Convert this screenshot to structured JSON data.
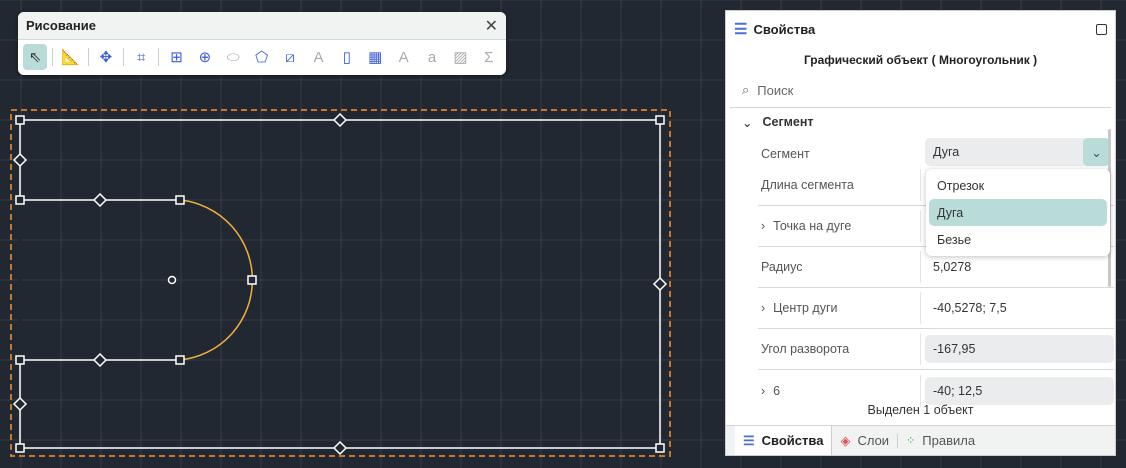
{
  "toolbar": {
    "title": "Рисование",
    "tools": [
      "select-icon",
      "ruler-icon",
      "move-icon",
      "crop-icon",
      "rectangle-icon",
      "circle-icon",
      "ellipse-icon",
      "polygon-icon",
      "line-icon",
      "text-frame-icon",
      "page-icon",
      "table-icon",
      "text-icon",
      "callout-icon",
      "image-icon",
      "formula-icon"
    ]
  },
  "panel": {
    "title": "Свойства",
    "object": "Графический объект ( Многоугольник )",
    "search_placeholder": "Поиск",
    "section": "Сегмент",
    "segment_label": "Сегмент",
    "segment_value": "Дуга",
    "options": [
      "Отрезок",
      "Дуга",
      "Безье"
    ],
    "rows": [
      {
        "label": "Длина сегмента",
        "value": ""
      },
      {
        "label": "Точка на дуге",
        "value": ""
      },
      {
        "label": "Радиус",
        "value": "5,0278"
      },
      {
        "label": "Центр дуги",
        "value": "-40,5278; 7,5"
      },
      {
        "label": "Угол разворота",
        "value": "-167,95"
      },
      {
        "label": "6",
        "value": "-40; 12,5"
      }
    ],
    "status": "Выделен 1 объект",
    "tabs": [
      "Свойства",
      "Слои",
      "Правила"
    ]
  },
  "colors": {
    "canvas": "#222831",
    "arc": "#f0b03c",
    "selection": "#c8782c",
    "accent": "#b9dcd9"
  }
}
